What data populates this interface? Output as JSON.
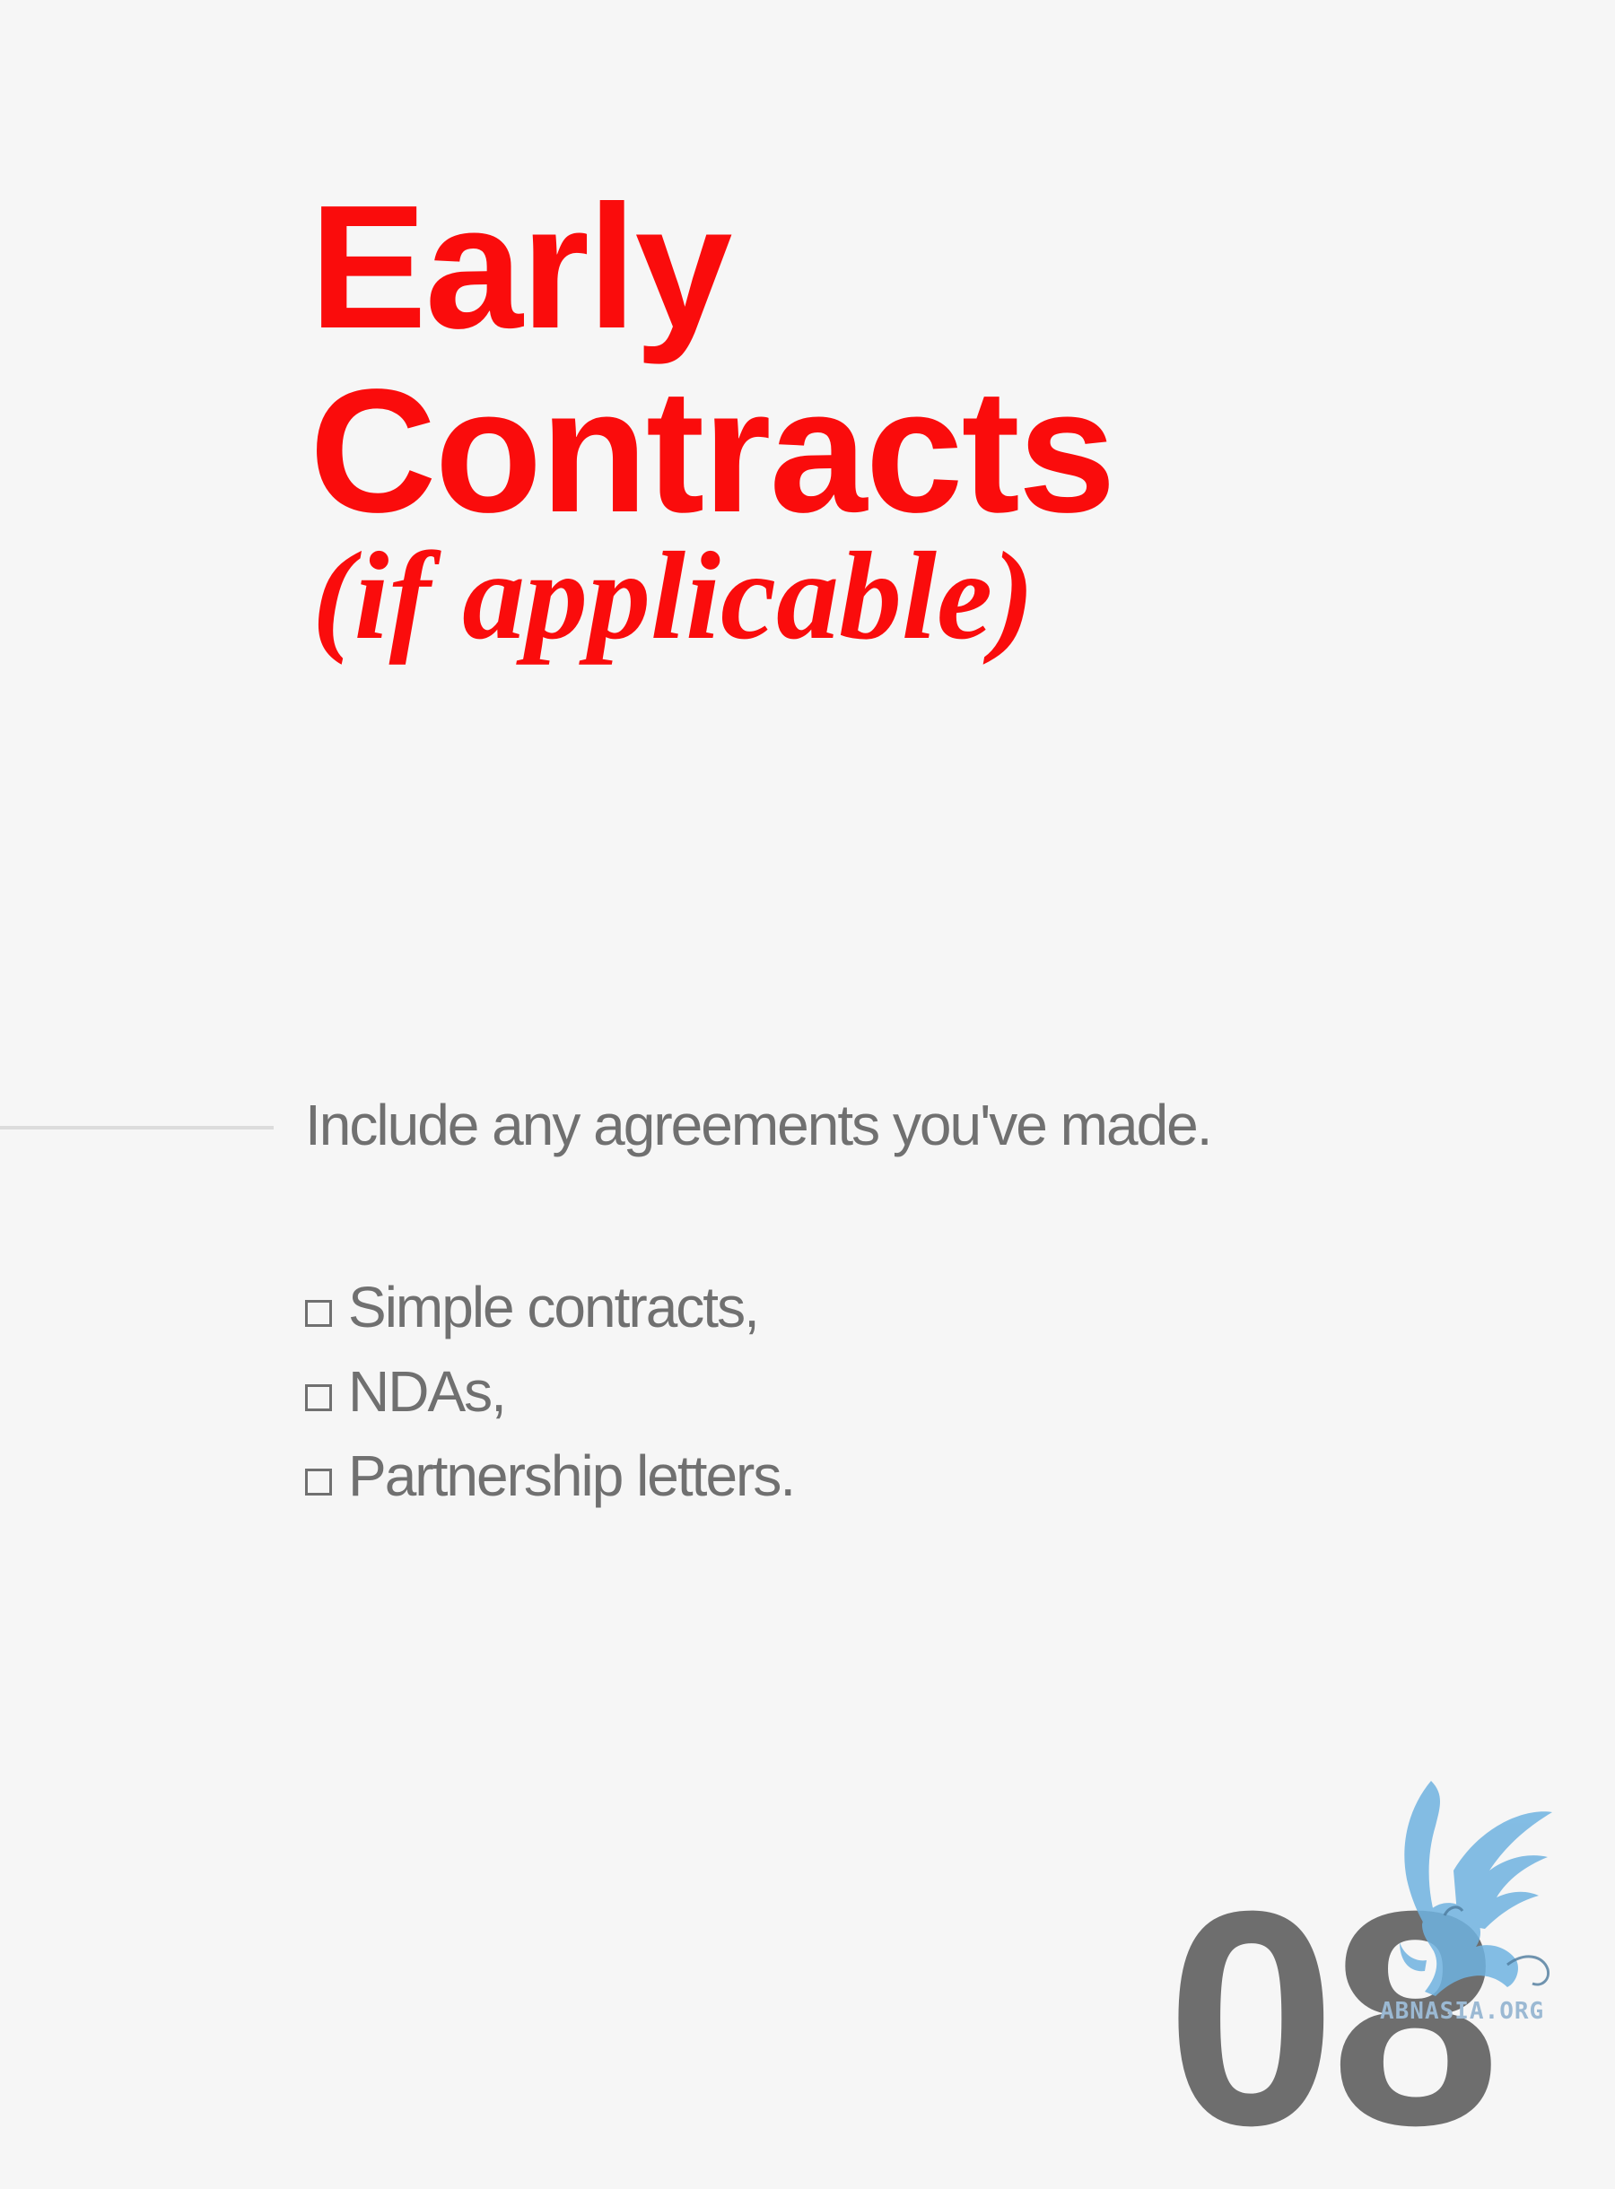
{
  "title": {
    "line1": "Early",
    "line2": "Contracts",
    "subtitle": "(if applicable)"
  },
  "intro": "Include any agreements you've made.",
  "checklist": [
    "Simple contracts,",
    "NDAs,",
    "Partnership letters."
  ],
  "page_number": "08",
  "watermark": "ABNASIA.ORG",
  "colors": {
    "accent": "#fa0c0c",
    "text": "#707070",
    "background": "#f6f6f6",
    "logo": "#6fb3e0"
  }
}
